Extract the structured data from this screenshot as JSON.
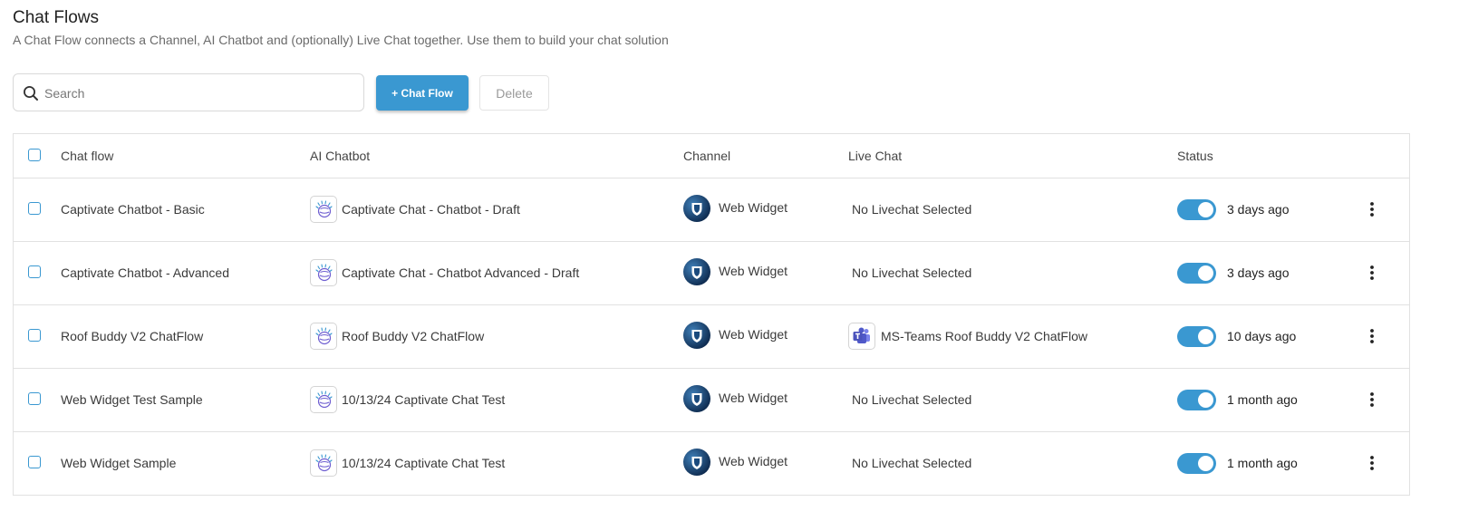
{
  "page": {
    "title": "Chat Flows",
    "subtitle": "A Chat Flow connects a Channel, AI Chatbot and (optionally) Live Chat together. Use them to build your chat solution"
  },
  "toolbar": {
    "search_placeholder": "Search",
    "add_label": "+ Chat Flow",
    "delete_label": "Delete"
  },
  "table": {
    "columns": {
      "chat_flow": "Chat flow",
      "ai_chatbot": "AI Chatbot",
      "channel": "Channel",
      "live_chat": "Live Chat",
      "status": "Status"
    },
    "rows": [
      {
        "name": "Captivate Chatbot - Basic",
        "chatbot": "Captivate Chat - Chatbot - Draft",
        "channel": "Web Widget",
        "live_chat": "No Livechat Selected",
        "live_chat_icon": "",
        "enabled": true,
        "updated": "3 days ago"
      },
      {
        "name": "Captivate Chatbot - Advanced",
        "chatbot": "Captivate Chat - Chatbot Advanced - Draft",
        "channel": "Web Widget",
        "live_chat": "No Livechat Selected",
        "live_chat_icon": "",
        "enabled": true,
        "updated": "3 days ago"
      },
      {
        "name": "Roof Buddy V2 ChatFlow",
        "chatbot": "Roof Buddy V2 ChatFlow",
        "channel": "Web Widget",
        "live_chat": "MS-Teams Roof Buddy V2 ChatFlow",
        "live_chat_icon": "teams-icon",
        "enabled": true,
        "updated": "10 days ago"
      },
      {
        "name": "Web Widget Test Sample",
        "chatbot": "10/13/24 Captivate Chat Test",
        "channel": "Web Widget",
        "live_chat": "No Livechat Selected",
        "live_chat_icon": "",
        "enabled": true,
        "updated": "1 month ago"
      },
      {
        "name": "Web Widget Sample",
        "chatbot": "10/13/24 Captivate Chat Test",
        "channel": "Web Widget",
        "live_chat": "No Livechat Selected",
        "live_chat_icon": "",
        "enabled": true,
        "updated": "1 month ago"
      }
    ]
  },
  "colors": {
    "accent": "#3a98d1",
    "border": "#e1e1e1",
    "channel_icon": "#0d2f57",
    "teams": "#5059c9",
    "watson": "#6f5fd1"
  },
  "icons": {
    "search": "search-icon",
    "chatbot": "watson-assistant-icon",
    "channel": "web-widget-icon",
    "live_chat": "teams-icon",
    "row_menu": "more-vertical-icon"
  }
}
